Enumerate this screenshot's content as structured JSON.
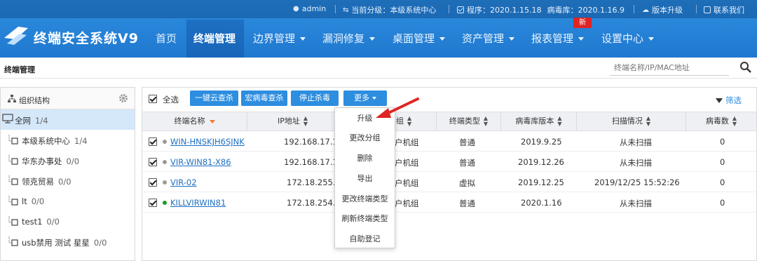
{
  "topbar": {
    "user": "admin",
    "level": "当前分级：本级系统中心",
    "program": "程序：2020.1.15.18",
    "virus_db": "病毒库：2020.1.16.9",
    "upgrade": "版本升级",
    "contact": "联系我们"
  },
  "app": {
    "title": "终端安全系统V9"
  },
  "nav": {
    "items": [
      {
        "label": "首页"
      },
      {
        "label": "终端管理"
      },
      {
        "label": "边界管理"
      },
      {
        "label": "漏洞修复"
      },
      {
        "label": "桌面管理"
      },
      {
        "label": "资产管理"
      },
      {
        "label": "报表管理"
      },
      {
        "label": "设置中心"
      }
    ],
    "new_badge": "新"
  },
  "breadcrumb": "终端管理",
  "search": {
    "placeholder": "终端名称/IP/MAC地址"
  },
  "sidebar": {
    "title": "组织结构",
    "items": [
      {
        "label": "全网",
        "count": "1/4"
      },
      {
        "label": "本级系统中心",
        "count": "1/4"
      },
      {
        "label": "华东办事处",
        "count": "0/0"
      },
      {
        "label": "领克贸易",
        "count": "0/0"
      },
      {
        "label": "lt",
        "count": "0/0"
      },
      {
        "label": "test1",
        "count": "0/0"
      },
      {
        "label": "usb禁用 测试 星星",
        "count": "0/0"
      }
    ]
  },
  "toolbar": {
    "select_all": "全选",
    "btn_cloud_scan": "一键云查杀",
    "btn_macro_scan": "宏病毒查杀",
    "btn_stop_scan": "停止杀毒",
    "btn_more": "更多",
    "filter": "筛选"
  },
  "table": {
    "headers": {
      "name": "终端名称",
      "ip": "IP地址",
      "group": "组",
      "type": "终端类型",
      "db_version": "病毒库版本",
      "scan": "扫描情况",
      "virus": "病毒数"
    },
    "rows": [
      {
        "name": "WIN-HNSKJH6SJNK",
        "ip": "192.168.17.1",
        "group": "户机组",
        "type": "普通",
        "db_version": "2019.9.25",
        "scan": "从未扫描",
        "virus": "0",
        "online": false
      },
      {
        "name": "VIR-WIN81-X86",
        "ip": "192.168.17.1",
        "group": "户机组",
        "type": "普通",
        "db_version": "2019.12.26",
        "scan": "从未扫描",
        "virus": "0",
        "online": false
      },
      {
        "name": "VIR-02",
        "ip": "172.18.255.2",
        "group": "户机组",
        "type": "虚拟",
        "db_version": "2019.12.25",
        "scan": "2019/12/25 15:52:26",
        "virus": "0",
        "online": false
      },
      {
        "name": "KILLVIRWIN81",
        "ip": "172.18.254.1",
        "group": "户机组",
        "type": "普通",
        "db_version": "2020.1.16",
        "scan": "从未扫描",
        "virus": "0",
        "online": true
      }
    ]
  },
  "more_menu": {
    "items": [
      "升级",
      "更改分组",
      "删除",
      "导出",
      "更改终端类型",
      "刷新终端类型",
      "自助登记"
    ]
  },
  "colors": {
    "header_blue": "#2f8fe0",
    "button_blue": "#2d8ddf",
    "link_blue": "#1e6fc2",
    "selected_row": "#d4e8fa",
    "badge_red": "#e02424",
    "arrow_red": "#e02424",
    "online_green": "#1a9a2a",
    "offline_gray": "#9a9a9a"
  }
}
